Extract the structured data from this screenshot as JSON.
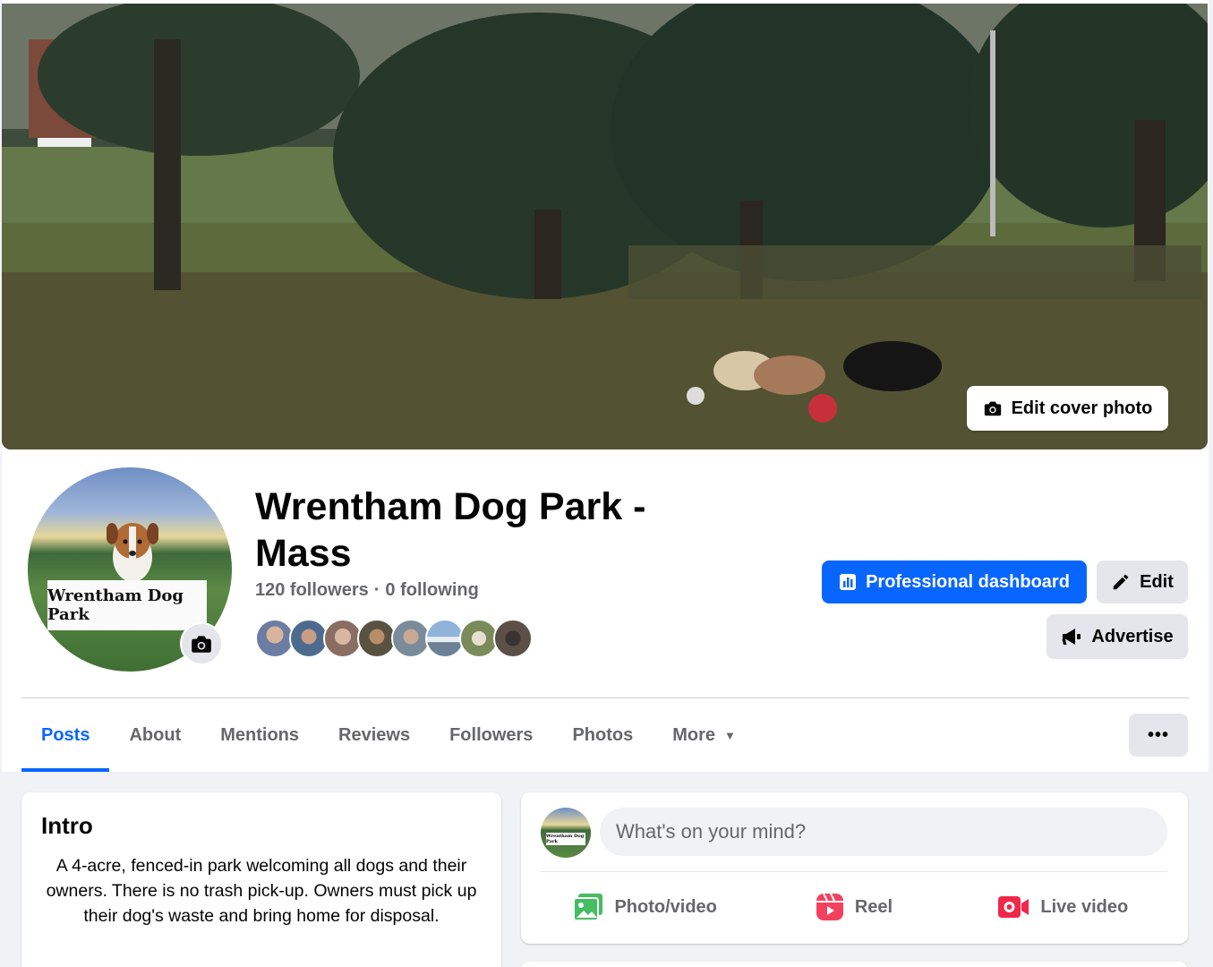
{
  "cover": {
    "edit_label": "Edit cover photo"
  },
  "profile": {
    "avatar_sign_text": "Wrentham Dog Park",
    "page_name": "Wrentham Dog Park - Mass",
    "followers": "120 followers",
    "separator": "·",
    "following": "0 following"
  },
  "actions": {
    "professional_dashboard": "Professional dashboard",
    "edit": "Edit",
    "advertise": "Advertise",
    "more_dots": "•••"
  },
  "tabs": [
    {
      "label": "Posts",
      "active": true
    },
    {
      "label": "About"
    },
    {
      "label": "Mentions"
    },
    {
      "label": "Reviews"
    },
    {
      "label": "Followers"
    },
    {
      "label": "Photos"
    },
    {
      "label": "More"
    }
  ],
  "intro": {
    "title": "Intro",
    "text": "A 4-acre, fenced-in park welcoming all dogs and their owners. There is no trash pick-up. Owners must pick up their dog's waste and bring home for disposal."
  },
  "composer": {
    "placeholder": "What's on your mind?",
    "avatar_sign_text": "Wrentham Dog Park",
    "photo_video": "Photo/video",
    "reel": "Reel",
    "live_video": "Live video"
  },
  "colors": {
    "accent": "#0866ff",
    "secondary_text": "#65676b",
    "button_grey": "#e4e6eb",
    "photo_icon": "#45bd62",
    "reel_icon": "#f3425f",
    "live_icon": "#f02849"
  }
}
